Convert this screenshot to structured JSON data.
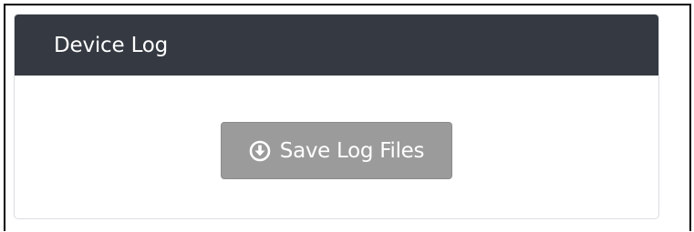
{
  "panel": {
    "title": "Device Log"
  },
  "actions": {
    "save_button": {
      "label": "Save Log Files",
      "icon": "download-circle-icon",
      "state": "disabled"
    }
  },
  "colors": {
    "header_background": "#353a42",
    "header_text": "#ffffff",
    "button_background": "#9b9b9b",
    "button_text": "#ffffff"
  }
}
